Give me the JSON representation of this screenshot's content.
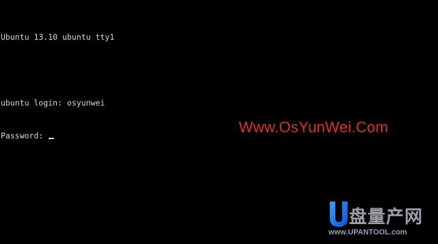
{
  "terminal": {
    "banner": "Ubuntu 13.10 ubuntu tty1",
    "login_line": "ubuntu login: osyunwei",
    "password_prompt": "Password: "
  },
  "watermark": {
    "site": "Www.OsYunWei.Com",
    "color": "#e0302a"
  },
  "logo": {
    "chinese_text": "盘量产网",
    "url": "www.UPANTOOL.com"
  }
}
